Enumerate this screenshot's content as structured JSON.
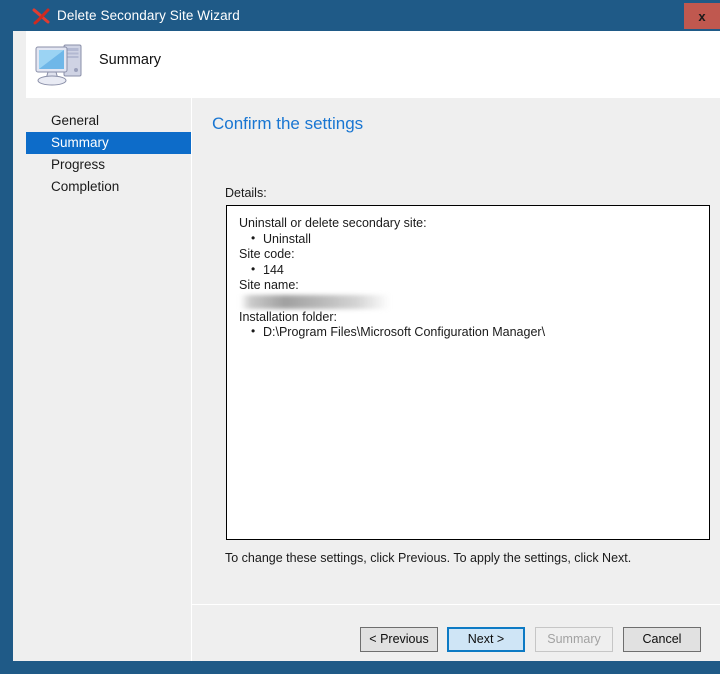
{
  "window": {
    "title": "Delete Secondary Site Wizard",
    "title_icon": "red-x-wizard-icon",
    "close_label": "x",
    "accent_color": "#1f5a87",
    "close_button_color": "#c0584f"
  },
  "header": {
    "icon": "computer-icon",
    "title": "Summary"
  },
  "sidebar": {
    "items": [
      {
        "label": "General",
        "selected": false
      },
      {
        "label": "Summary",
        "selected": true
      },
      {
        "label": "Progress",
        "selected": false
      },
      {
        "label": "Completion",
        "selected": false
      }
    ],
    "selected_color": "#0d6cc9"
  },
  "main": {
    "heading": "Confirm the settings",
    "heading_color": "#1976d2",
    "details_label": "Details:",
    "details": [
      {
        "type": "head",
        "text": "Uninstall or delete secondary site:"
      },
      {
        "type": "bullet",
        "text": "Uninstall"
      },
      {
        "type": "head",
        "text": "Site code:"
      },
      {
        "type": "bullet",
        "text": "144"
      },
      {
        "type": "head",
        "text": "Site name:"
      },
      {
        "type": "redacted",
        "text": ""
      },
      {
        "type": "head",
        "text": "Installation folder:"
      },
      {
        "type": "bullet",
        "text": "D:\\Program Files\\Microsoft Configuration Manager\\"
      }
    ],
    "footnote": "To change these settings, click Previous. To apply the settings, click Next."
  },
  "footer": {
    "buttons": [
      {
        "label": "< Previous",
        "state": "normal"
      },
      {
        "label": "Next >",
        "state": "focused"
      },
      {
        "label": "Summary",
        "state": "disabled"
      },
      {
        "label": "Cancel",
        "state": "normal"
      }
    ]
  }
}
